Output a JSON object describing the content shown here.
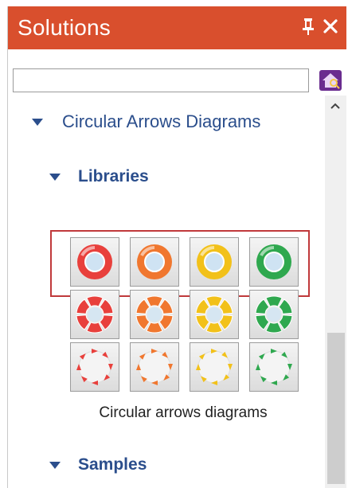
{
  "panel": {
    "title": "Solutions",
    "pin_glyph": "1",
    "close_glyph": "✕"
  },
  "search": {
    "value": "",
    "placeholder": ""
  },
  "tree": {
    "category": "Circular Arrows Diagrams",
    "libraries_label": "Libraries",
    "samples_label": "Samples",
    "library_caption": "Circular arrows diagrams"
  },
  "colors": {
    "titlebar": "#d94f2d",
    "tree_text": "#2b4e8c",
    "highlight": "#c0393b",
    "red": "#e8403c",
    "orange": "#f0772f",
    "yellow": "#f2c11a",
    "green": "#2fa84f"
  },
  "icons": [
    {
      "name": "red-ring-icon",
      "style": "ring",
      "color": "#e8403c"
    },
    {
      "name": "orange-ring-icon",
      "style": "ring",
      "color": "#f0772f"
    },
    {
      "name": "yellow-ring-icon",
      "style": "ring",
      "color": "#f2c11a"
    },
    {
      "name": "green-ring-icon",
      "style": "ring",
      "color": "#2fa84f"
    },
    {
      "name": "red-segmented-ring-icon",
      "style": "segmented",
      "color": "#e8403c"
    },
    {
      "name": "orange-segmented-ring-icon",
      "style": "segmented",
      "color": "#f0772f"
    },
    {
      "name": "yellow-segmented-ring-icon",
      "style": "segmented",
      "color": "#f2c11a"
    },
    {
      "name": "green-segmented-ring-icon",
      "style": "segmented",
      "color": "#2fa84f"
    },
    {
      "name": "red-arrow-circle-icon",
      "style": "arrows",
      "color": "#e8403c"
    },
    {
      "name": "orange-arrow-circle-icon",
      "style": "arrows",
      "color": "#f0772f"
    },
    {
      "name": "yellow-arrow-circle-icon",
      "style": "arrows",
      "color": "#f2c11a"
    },
    {
      "name": "green-arrow-circle-icon",
      "style": "arrows",
      "color": "#2fa84f"
    }
  ]
}
